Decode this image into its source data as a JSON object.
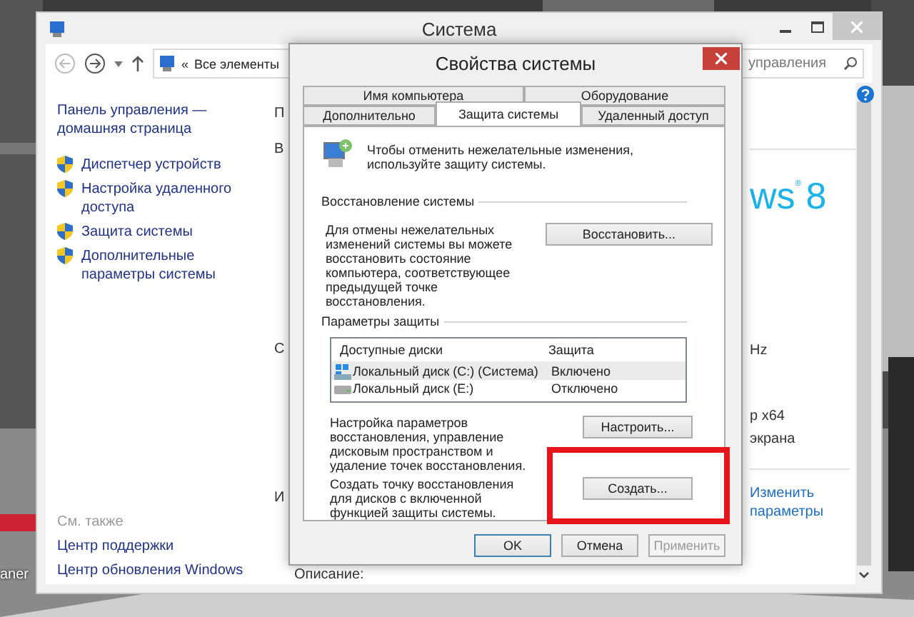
{
  "desktop": {
    "icon_label": "aner"
  },
  "main_window": {
    "title": "Система",
    "address": {
      "chevron": "«",
      "text": "Все элементы"
    },
    "search": {
      "placeholder": "управления"
    },
    "sidebar": {
      "home_link": "Панель управления — домашняя страница",
      "items": [
        "Диспетчер устройств",
        "Настройка удаленного доступа",
        "Защита системы",
        "Дополнительные параметры системы"
      ],
      "see_also": {
        "heading": "См. также",
        "links": [
          "Центр поддержки",
          "Центр обновления Windows"
        ]
      }
    },
    "fragments": [
      "П",
      "В",
      "С",
      "И"
    ],
    "logo": {
      "text": "ws",
      "mark": "®",
      "version": "8"
    },
    "details": [
      "Hz",
      "р x64",
      "экрана"
    ],
    "change_link": "Изменить параметры",
    "description_label": "Описание:"
  },
  "dialog": {
    "title": "Свойства системы",
    "tab_rows": [
      [
        {
          "label": "Имя компьютера",
          "selected": false
        },
        {
          "label": "Оборудование",
          "selected": false
        }
      ],
      [
        {
          "label": "Дополнительно",
          "selected": false
        },
        {
          "label": "Защита системы",
          "selected": true
        },
        {
          "label": "Удаленный доступ",
          "selected": false
        }
      ]
    ],
    "intro": "Чтобы отменить нежелательные изменения, используйте защиту системы.",
    "restore": {
      "heading": "Восстановление системы",
      "text": "Для отмены нежелательных изменений системы вы можете восстановить состояние компьютера, соответствующее предыдущей точке восстановления.",
      "button": "Восстановить..."
    },
    "protection": {
      "heading": "Параметры защиты",
      "columns": [
        "Доступные диски",
        "Защита"
      ],
      "drives": [
        {
          "kind": "system",
          "name": "Локальный диск (C:) (Система)",
          "status": "Включено",
          "selected": true
        },
        {
          "kind": "disk",
          "name": "Локальный диск (E:)",
          "status": "Отключено",
          "selected": false
        }
      ],
      "configure": {
        "text": "Настройка параметров восстановления, управление дисковым пространством и удаление точек восстановления.",
        "button": "Настроить..."
      },
      "create": {
        "text": "Создать точку восстановления для дисков с включенной функцией защиты системы.",
        "button": "Создать...",
        "highlighted": true
      }
    },
    "buttons": [
      {
        "label": "OK",
        "default": true,
        "disabled": false
      },
      {
        "label": "Отмена",
        "default": false,
        "disabled": false
      },
      {
        "label": "Применить",
        "default": false,
        "disabled": true
      }
    ]
  }
}
